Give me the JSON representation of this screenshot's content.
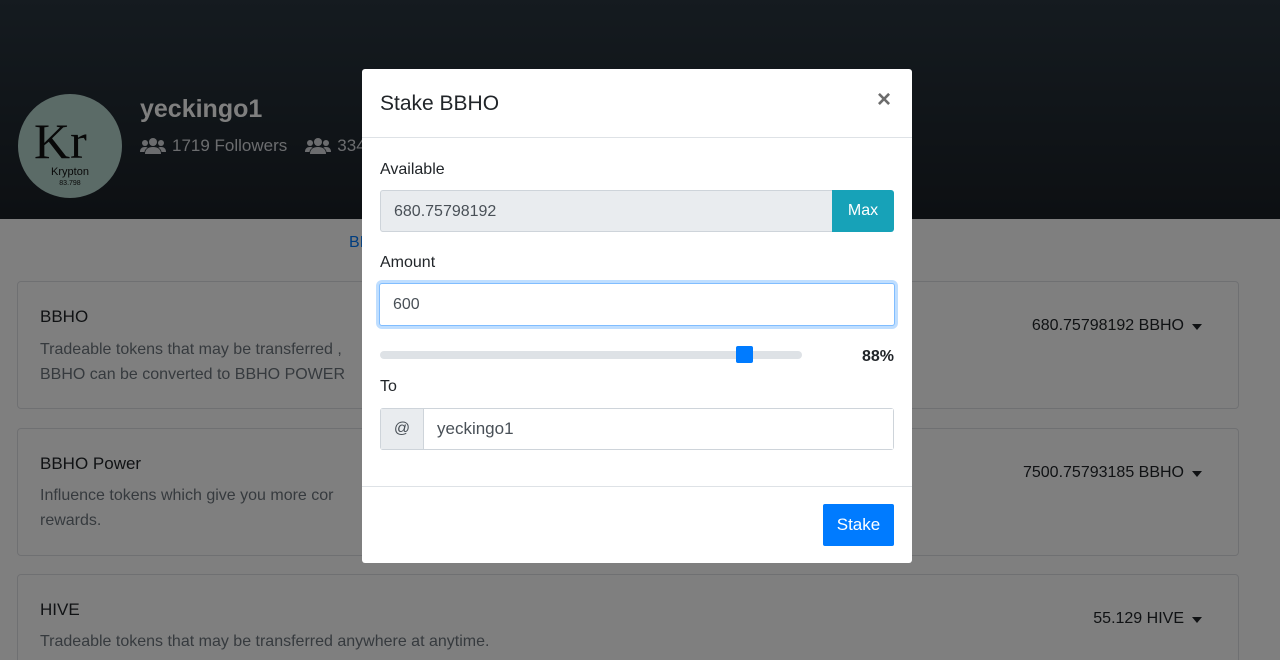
{
  "profile": {
    "username": "yeckingo1",
    "followers": "1719 Followers",
    "following": "334",
    "avatar": {
      "symbol": "Kr",
      "element": "Krypton",
      "mass": "83.798"
    }
  },
  "tabs": {
    "active_fragment": "BI"
  },
  "cards": [
    {
      "name": "BBHO",
      "description": "Tradeable tokens that may be transferred , BBHO can be converted to BBHO POWER",
      "balance": "680.75798192 BBHO"
    },
    {
      "name": "BBHO Power",
      "description": "Influence tokens which give you more cor rewards.",
      "balance": "7500.75793185 BBHO"
    },
    {
      "name": "HIVE",
      "description": "Tradeable tokens that may be transferred anywhere at anytime.",
      "balance": "55.129 HIVE"
    }
  ],
  "modal": {
    "title": "Stake BBHO",
    "close_symbol": "×",
    "available_label": "Available",
    "available_value": "680.75798192",
    "max_label": "Max",
    "amount_label": "Amount",
    "amount_value": "600",
    "slider_percent": 88,
    "slider_percent_label": "88%",
    "to_label": "To",
    "to_prefix": "@",
    "to_value": "yeckingo1",
    "stake_label": "Stake"
  },
  "icons": {
    "followers": "users-icon",
    "following": "users-icon",
    "close": "close-icon"
  },
  "colors": {
    "primary": "#007bff",
    "info": "#17a2b8",
    "header_bg": "#1f272e"
  }
}
